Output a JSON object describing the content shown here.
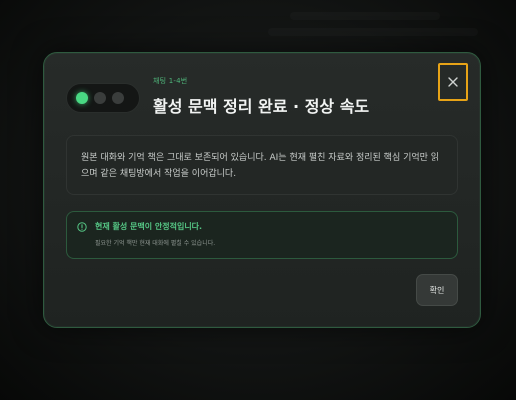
{
  "modal": {
    "subtitle": "채팅 1-4번",
    "title": "활성 문맥 정리 완료 · 정상 속도",
    "description": "원본 대화와 기억 책은 그대로 보존되어 있습니다. AI는 현재 펼친 자료와 정리된 핵심 기억만 읽으며 같은 채팅방에서 작업을 이어갑니다.",
    "notice": {
      "title": "현재 활성 문맥이 안정적입니다.",
      "subtitle": "필요한 기억 책만 현재 대화에 펼칠 수 있습니다."
    },
    "confirm_label": "확인"
  },
  "status_indicator": {
    "active_index": 0,
    "count": 3,
    "active_color": "#49d883"
  },
  "icons": {
    "close": "close-icon",
    "notice": "info-circle-icon"
  },
  "colors": {
    "accent": "#49d883",
    "close_focus_border": "#e7a317",
    "modal_border": "#2f5a3f"
  }
}
